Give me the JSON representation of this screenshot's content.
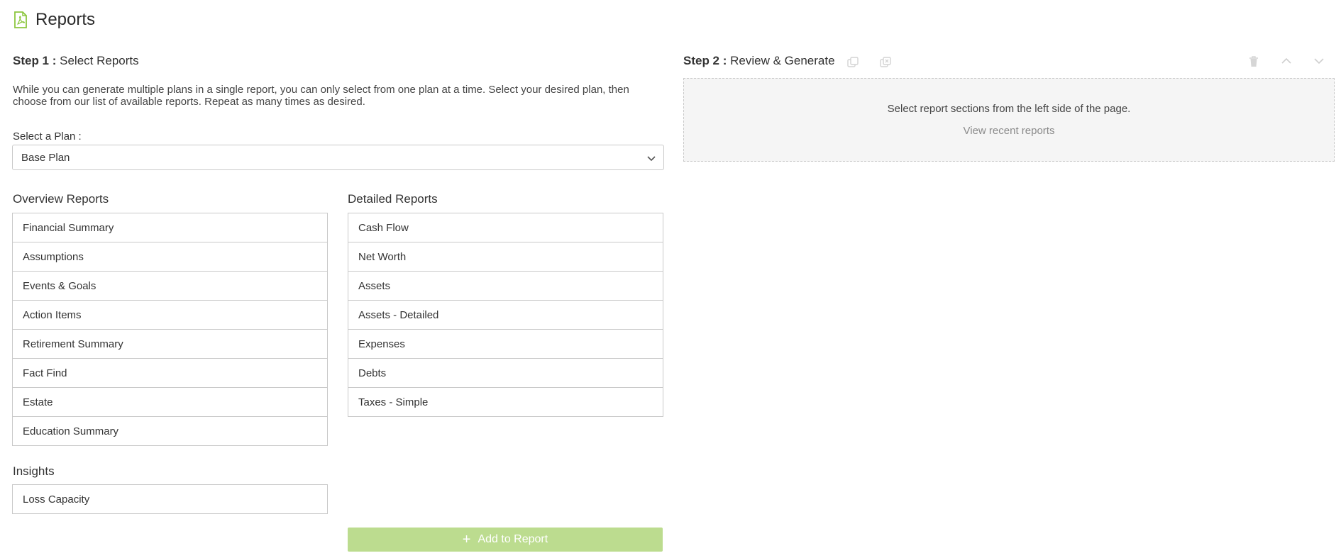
{
  "header": {
    "title": "Reports",
    "icon": "pdf-file-icon",
    "accent": "#8cc63f"
  },
  "step1": {
    "prefix": "Step 1 :",
    "title": "Select Reports",
    "intro": "While you can generate multiple plans in a single report, you can only select from one plan at a time. Select your desired plan, then choose from our list of available reports. Repeat as many times as desired.",
    "plan_label": "Select a Plan :",
    "plan_value": "Base Plan"
  },
  "overview": {
    "title": "Overview Reports",
    "items": [
      "Financial Summary",
      "Assumptions",
      "Events & Goals",
      "Action Items",
      "Retirement Summary",
      "Fact Find",
      "Estate",
      "Education Summary"
    ]
  },
  "detailed": {
    "title": "Detailed Reports",
    "items": [
      "Cash Flow",
      "Net Worth",
      "Assets",
      "Assets - Detailed",
      "Expenses",
      "Debts",
      "Taxes - Simple"
    ]
  },
  "insights": {
    "title": "Insights",
    "items": [
      "Loss Capacity"
    ]
  },
  "add_button": {
    "label": "Add to Report",
    "icon": "plus-icon",
    "color": "#bcdc8f"
  },
  "step2": {
    "prefix": "Step 2 :",
    "title": "Review & Generate",
    "empty_message": "Select report sections from the left side of the page.",
    "recent_link": "View recent reports",
    "toolbar_icons": [
      "copy-icon",
      "copy-delete-icon",
      "trash-icon",
      "chevron-up-icon",
      "chevron-down-icon"
    ]
  }
}
